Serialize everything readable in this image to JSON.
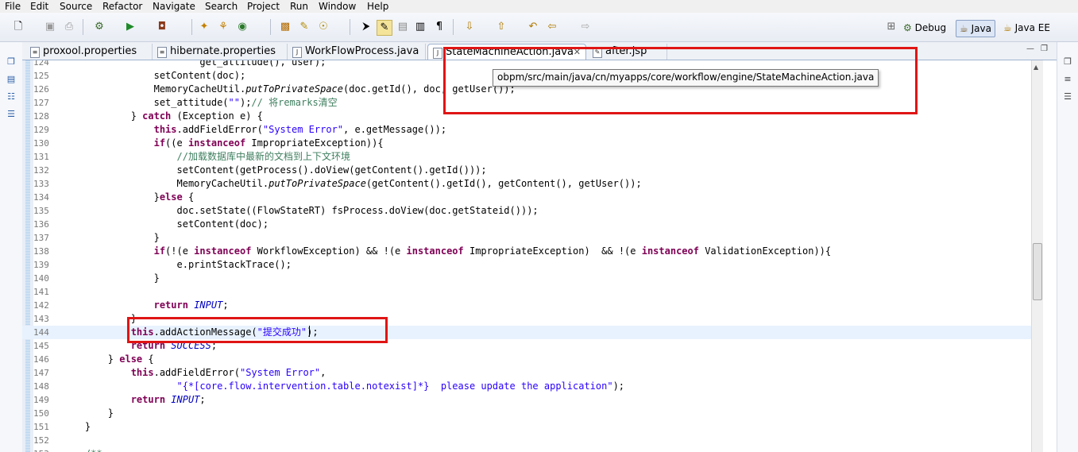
{
  "menu": [
    "File",
    "Edit",
    "Source",
    "Refactor",
    "Navigate",
    "Search",
    "Project",
    "Run",
    "Window",
    "Help"
  ],
  "perspectives": [
    {
      "label": "Debug",
      "icon": "debug-icon",
      "active": false
    },
    {
      "label": "Java",
      "icon": "java-perspective-icon",
      "active": true
    },
    {
      "label": "Java EE",
      "icon": "java-ee-icon",
      "active": false
    }
  ],
  "tabs": [
    {
      "label": "proxool.properties",
      "active": false
    },
    {
      "label": "hibernate.properties",
      "active": false
    },
    {
      "label": "WorkFlowProcess.java",
      "active": false
    },
    {
      "label": "StateMachineAction.java",
      "active": true
    },
    {
      "label": "after.jsp",
      "active": false
    }
  ],
  "tooltip": "obpm/src/main/java/cn/myapps/core/workflow/engine/StateMachineAction.java",
  "editor": {
    "current_line": "144",
    "lines": [
      {
        "n": "124",
        "text": "                        get_attitude(), user);"
      },
      {
        "n": "125",
        "text": "                setContent(doc);"
      },
      {
        "n": "126",
        "text": "                MemoryCacheUtil.putToPrivateSpace(doc.getId(), doc, getUser());"
      },
      {
        "n": "127",
        "text": "                set_attitude(\"\");// 将remarks清空"
      },
      {
        "n": "128",
        "text": "            } catch (Exception e) {"
      },
      {
        "n": "129",
        "text": "                this.addFieldError(\"System Error\", e.getMessage());"
      },
      {
        "n": "130",
        "text": "                if((e instanceof ImpropriateException)){"
      },
      {
        "n": "131",
        "text": "                    //加载数据库中最新的文档到上下文环境"
      },
      {
        "n": "132",
        "text": "                    setContent(getProcess().doView(getContent().getId()));"
      },
      {
        "n": "133",
        "text": "                    MemoryCacheUtil.putToPrivateSpace(getContent().getId(), getContent(), getUser());"
      },
      {
        "n": "134",
        "text": "                }else {"
      },
      {
        "n": "135",
        "text": "                    doc.setState((FlowStateRT) fsProcess.doView(doc.getStateid()));"
      },
      {
        "n": "136",
        "text": "                    setContent(doc);"
      },
      {
        "n": "137",
        "text": "                }"
      },
      {
        "n": "138",
        "text": "                if(!(e instanceof WorkflowException) && !(e instanceof ImpropriateException)  && !(e instanceof ValidationException)){"
      },
      {
        "n": "139",
        "text": "                    e.printStackTrace();"
      },
      {
        "n": "140",
        "text": "                }"
      },
      {
        "n": "141",
        "text": ""
      },
      {
        "n": "142",
        "text": "                return INPUT;"
      },
      {
        "n": "143",
        "text": "            }"
      },
      {
        "n": "144",
        "text": "            this.addActionMessage(\"提交成功\");"
      },
      {
        "n": "145",
        "text": "            return SUCCESS;"
      },
      {
        "n": "146",
        "text": "        } else {"
      },
      {
        "n": "147",
        "text": "            this.addFieldError(\"System Error\","
      },
      {
        "n": "148",
        "text": "                    \"{*[core.flow.intervention.table.notexist]*}  please update the application\");"
      },
      {
        "n": "149",
        "text": "            return INPUT;"
      },
      {
        "n": "150",
        "text": "        }"
      },
      {
        "n": "151",
        "text": "    }"
      },
      {
        "n": "152",
        "text": ""
      },
      {
        "n": "153",
        "text": "    /**"
      }
    ]
  },
  "colors": {
    "keyword": "#7f0055",
    "string": "#2a00ff",
    "comment": "#3f7f5f",
    "annotation_box": "#e01515",
    "current_line": "#e8f2fe"
  }
}
